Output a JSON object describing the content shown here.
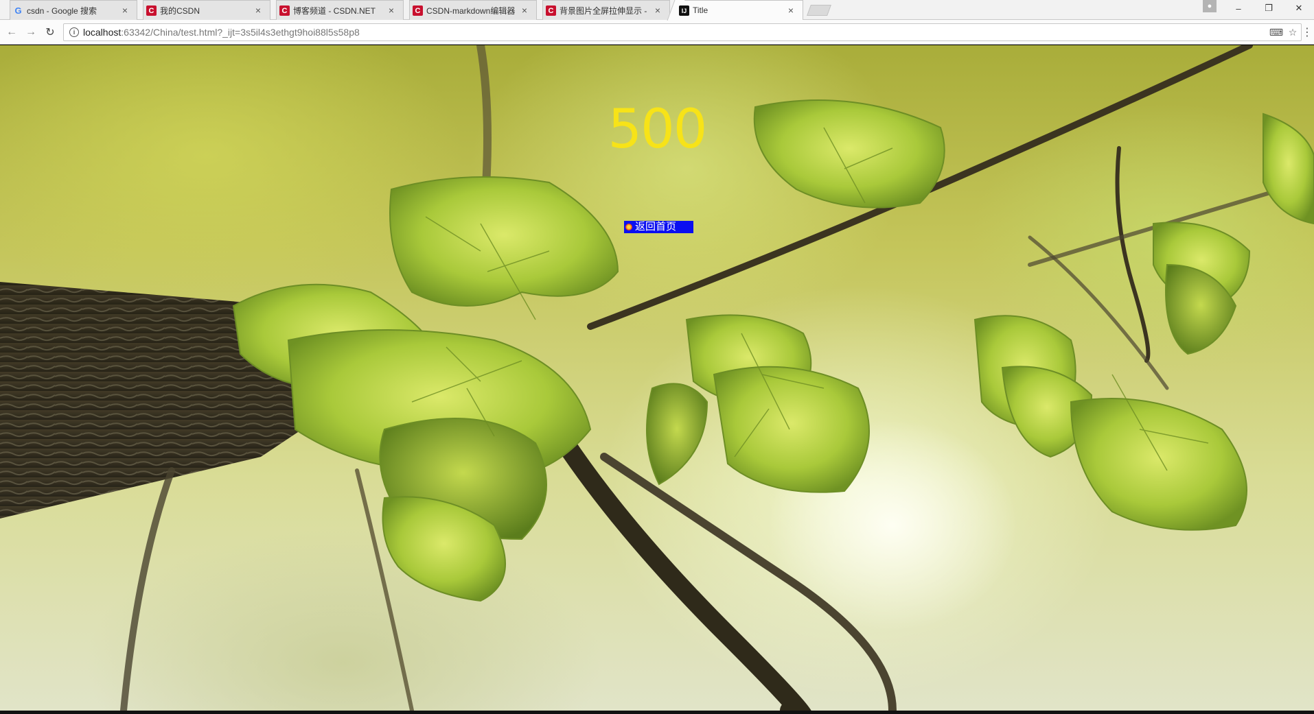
{
  "browser": {
    "tabs": [
      {
        "label": "csdn - Google 搜索",
        "favicon": "google-g-icon",
        "active": false
      },
      {
        "label": "我的CSDN",
        "favicon": "csdn-icon",
        "active": false
      },
      {
        "label": "博客频道 - CSDN.NET",
        "favicon": "csdn-icon",
        "active": false
      },
      {
        "label": "CSDN-markdown编辑器",
        "favicon": "csdn-icon",
        "active": false
      },
      {
        "label": "背景图片全屏拉伸显示 -",
        "favicon": "csdn-icon",
        "active": false
      },
      {
        "label": "Title",
        "favicon": "intellij-icon",
        "active": true
      }
    ],
    "tab_close_glyph": "×",
    "address": {
      "host": "localhost",
      "path": ":63342/China/test.html?_ijt=3s5il4s3ethgt9hoi88l5s58p8"
    }
  },
  "page": {
    "error_code": "500",
    "home_link_label": "返回首页"
  },
  "colors": {
    "error_code": "#f7e318",
    "home_link_bg": "#0a0ff0",
    "home_link_text": "#ffffff"
  }
}
